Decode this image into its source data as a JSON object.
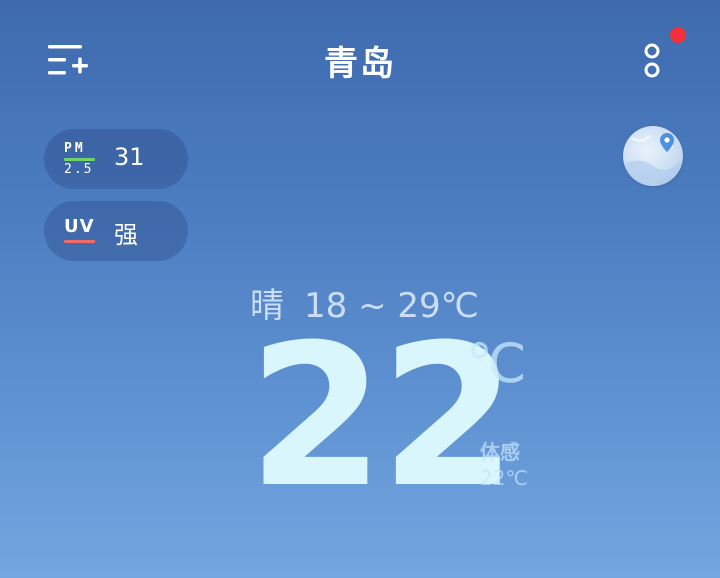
{
  "header": {
    "city": "青岛"
  },
  "badges": {
    "pm": {
      "label_top": "PM",
      "label_bottom": "2.5",
      "value": "31"
    },
    "uv": {
      "label": "UV",
      "value": "强"
    }
  },
  "weather": {
    "condition": "晴",
    "range": "18 ~ 29℃",
    "temperature": "22",
    "unit": "℃",
    "feels_like_label": "体感",
    "feels_like_value": "22℃"
  },
  "colors": {
    "notification_dot": "#f2313a",
    "pm_underline": "#6fd46a",
    "uv_underline": "#f06a6a",
    "temperature": "#d8f6fb"
  },
  "icons": {
    "menu": "menu-add-icon",
    "more": "more-vertical-icon",
    "map": "map-location-icon"
  }
}
